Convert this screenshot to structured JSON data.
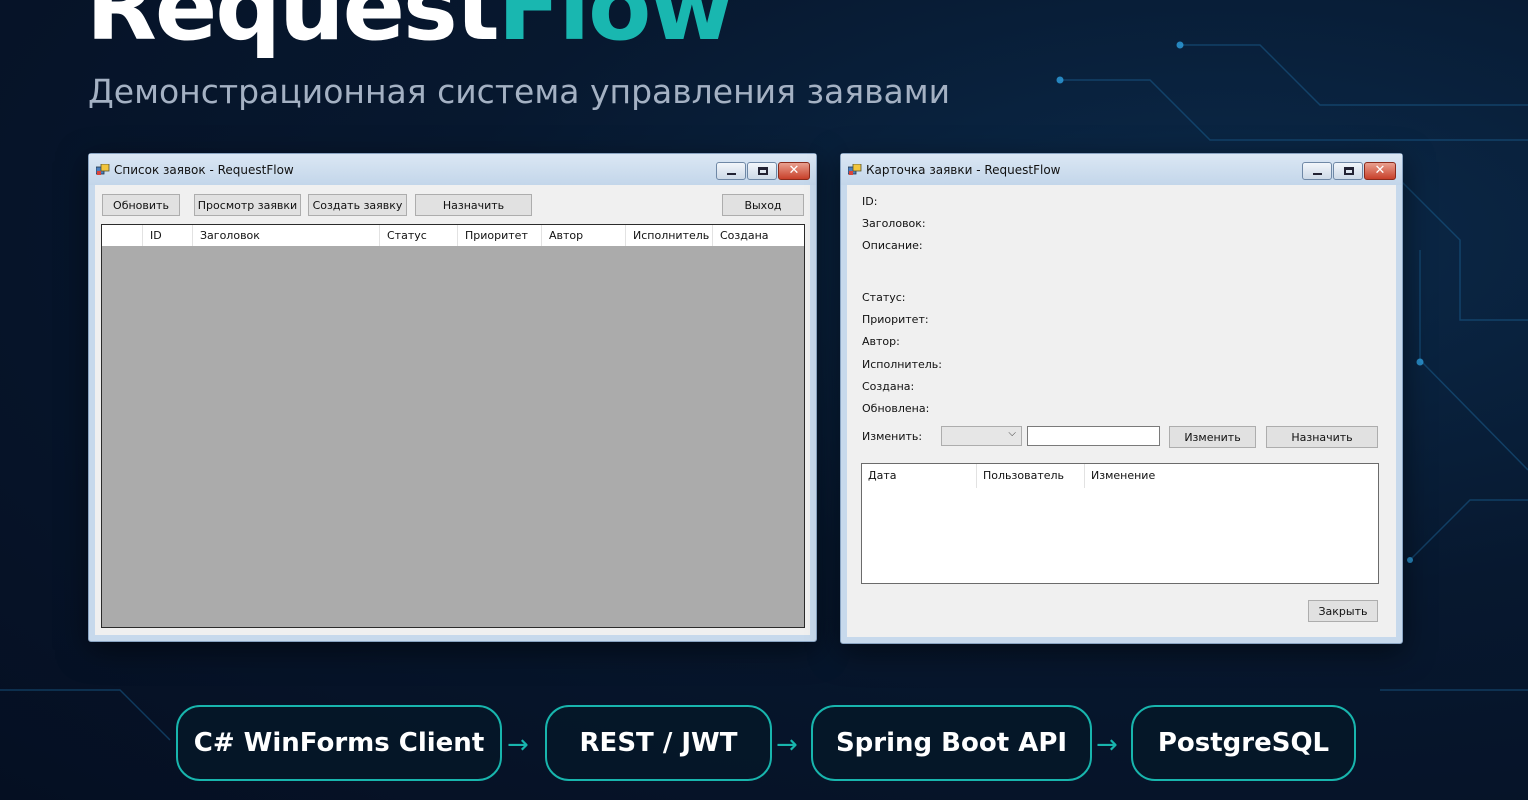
{
  "hero": {
    "title_main": "Request",
    "title_accent": "Flow",
    "subtitle": "Демонстрационная система управления заявами"
  },
  "list_window": {
    "title": "Список заявок - RequestFlow",
    "toolbar": {
      "refresh": "Обновить",
      "view": "Просмотр заявки",
      "create": "Создать заявку",
      "assign": "Назначить",
      "exit": "Выход"
    },
    "columns": [
      "ID",
      "Заголовок",
      "Статус",
      "Приоритет",
      "Автор",
      "Исполнитель",
      "Создана"
    ]
  },
  "card_window": {
    "title": "Карточка заявки - RequestFlow",
    "fields": {
      "id": "ID:",
      "heading": "Заголовок:",
      "description": "Описание:",
      "status": "Статус:",
      "priority": "Приоритет:",
      "author": "Автор:",
      "assignee": "Исполнитель:",
      "created": "Создана:",
      "updated": "Обновлена:"
    },
    "change_label": "Изменить:",
    "change_button": "Изменить",
    "assign_button": "Назначить",
    "history_columns": [
      "Дата",
      "Пользователь",
      "Изменение"
    ],
    "close_button": "Закрыть"
  },
  "pipeline": {
    "steps": [
      "C# WinForms Client",
      "REST / JWT",
      "Spring Boot API",
      "PostgreSQL"
    ],
    "arrow": "→"
  },
  "colors": {
    "accent": "#19b7b0",
    "background": "#07182f",
    "grid_empty": "#ababab"
  },
  "icons": {
    "app": "app-window-icon",
    "minimize": "minimize-icon",
    "maximize": "maximize-icon",
    "close": "close-icon",
    "dropdown": "chevron-down-icon"
  }
}
